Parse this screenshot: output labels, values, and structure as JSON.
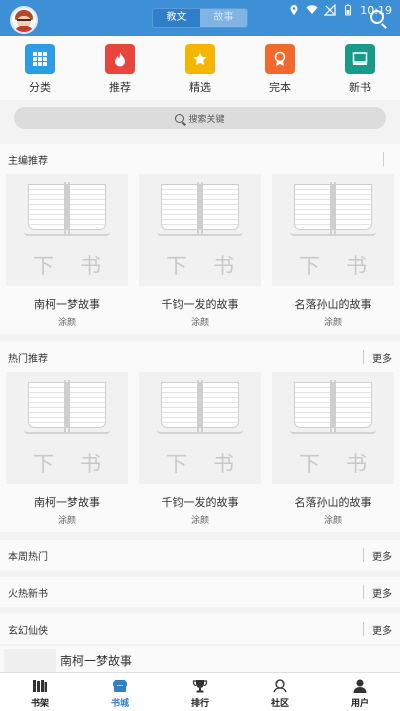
{
  "status": {
    "time": "10:19"
  },
  "header": {
    "tabs": [
      {
        "label": "教文",
        "active": true
      },
      {
        "label": "故事",
        "active": false
      }
    ]
  },
  "categories": [
    {
      "label": "分类",
      "color": "#2d9be6",
      "icon": "grid-icon"
    },
    {
      "label": "推荐",
      "color": "#e8453c",
      "icon": "flame-icon"
    },
    {
      "label": "精选",
      "color": "#f5b500",
      "icon": "star-icon"
    },
    {
      "label": "完本",
      "color": "#f2692e",
      "icon": "badge-icon"
    },
    {
      "label": "新书",
      "color": "#1a9b8a",
      "icon": "book-icon"
    }
  ],
  "search": {
    "placeholder": "搜索关键"
  },
  "cover_brand": "下书",
  "sections": {
    "editor": {
      "title": "主编推荐",
      "more": "",
      "books": [
        {
          "title": "南柯一梦故事",
          "author": "涂颜"
        },
        {
          "title": "千钧一发的故事",
          "author": "涂颜"
        },
        {
          "title": "名落孙山的故事",
          "author": "涂颜"
        }
      ]
    },
    "hot": {
      "title": "热门推荐",
      "more": "更多",
      "books": [
        {
          "title": "南柯一梦故事",
          "author": "涂颜"
        },
        {
          "title": "千钧一发的故事",
          "author": "涂颜"
        },
        {
          "title": "名落孙山的故事",
          "author": "涂颜"
        }
      ]
    },
    "weekly": {
      "title": "本周热门",
      "more": "更多"
    },
    "newhot": {
      "title": "火热新书",
      "more": "更多"
    },
    "xuanhuan": {
      "title": "玄幻仙侠",
      "more": "更多",
      "first_item": "南柯一梦故事"
    }
  },
  "nav": [
    {
      "label": "书架",
      "icon": "bookshelf-icon",
      "active": false
    },
    {
      "label": "书城",
      "icon": "store-icon",
      "active": true
    },
    {
      "label": "排行",
      "icon": "trophy-icon",
      "active": false
    },
    {
      "label": "社区",
      "icon": "community-icon",
      "active": false
    },
    {
      "label": "用户",
      "icon": "user-icon",
      "active": false
    }
  ],
  "colors": {
    "header": "#3d8fd6",
    "accent": "#2f80c8"
  }
}
